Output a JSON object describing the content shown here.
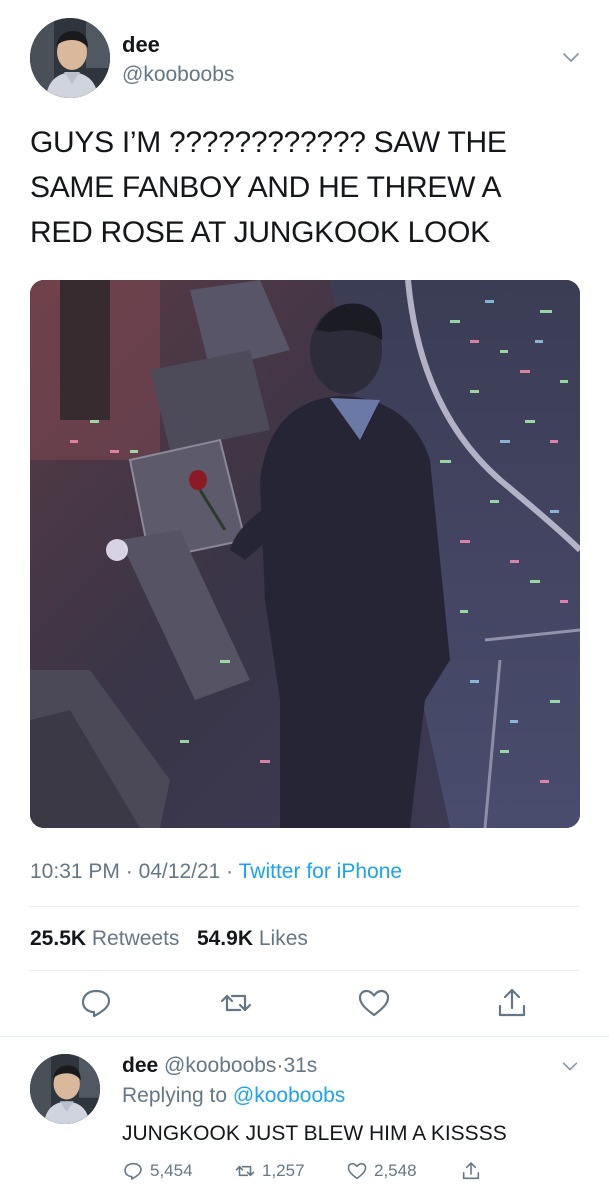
{
  "tweet": {
    "author": {
      "display_name": "dee",
      "handle": "@kooboobs"
    },
    "text_lines": [
      "GUYS I’M ???????????? SAW THE",
      "SAME FANBOY AND HE THREW A",
      "RED ROSE AT JUNGKOOK LOOK"
    ],
    "time": "10:31 PM",
    "date": "04/12/21",
    "separator": "·",
    "source": "Twitter for iPhone",
    "retweets_count": "25.5K",
    "retweets_label": "Retweets",
    "likes_count": "54.9K",
    "likes_label": "Likes",
    "actions": [
      "reply-icon",
      "retweet-icon",
      "like-icon",
      "share-icon"
    ]
  },
  "reply": {
    "display_name": "dee",
    "handle": "@kooboobs",
    "separator": "·",
    "time_ago": "31s",
    "replying_prefix": "Replying to",
    "replying_to": "@kooboobs",
    "text": "JUNGKOOK JUST BLEW HIM A KISSSS",
    "reply_count": "5,454",
    "retweet_count": "1,257",
    "like_count": "2,548"
  },
  "colors": {
    "accent": "#1da1f2",
    "secondary_text": "#657786",
    "primary_text": "#14171a",
    "divider": "#e6ecf0"
  }
}
